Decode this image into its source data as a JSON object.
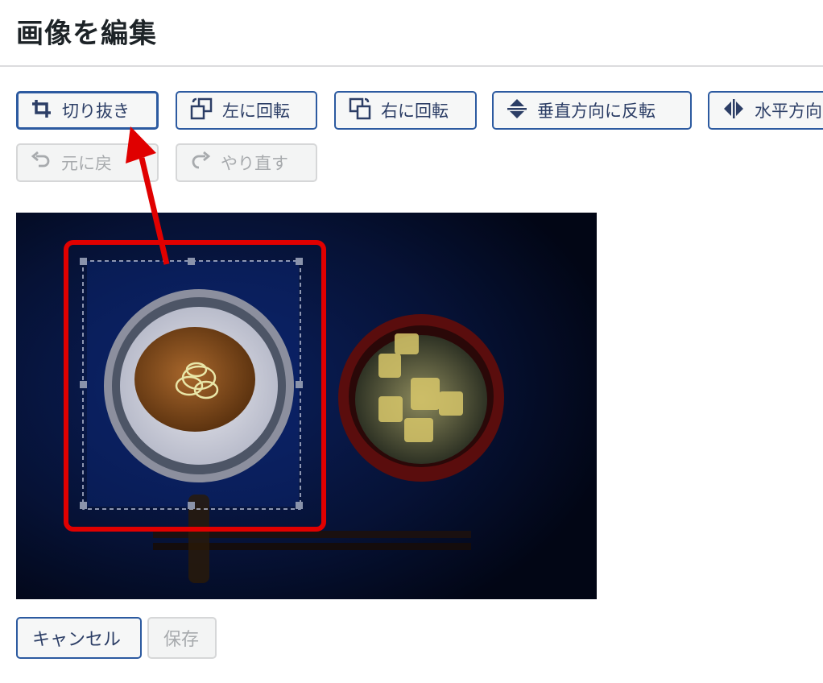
{
  "header": {
    "title": "画像を編集"
  },
  "toolbar": {
    "crop": "切り抜き",
    "rotate_left": "左に回転",
    "rotate_right": "右に回転",
    "flip_vertical": "垂直方向に反転",
    "flip_horizontal": "水平方向",
    "undo": "元に戻",
    "redo": "やり直す"
  },
  "footer": {
    "cancel": "キャンセル",
    "save": "保存"
  },
  "colors": {
    "accent": "#2c5aa0",
    "highlight": "#e00000",
    "canvas_bg": "#03081a"
  },
  "icons": [
    "crop-icon",
    "rotate-left-icon",
    "rotate-right-icon",
    "flip-vertical-icon",
    "flip-horizontal-icon",
    "undo-icon",
    "redo-icon"
  ]
}
